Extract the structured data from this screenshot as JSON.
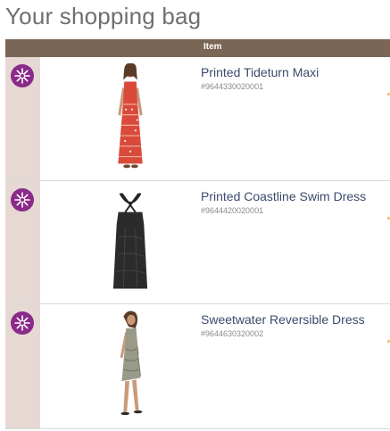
{
  "page": {
    "title": "Your shopping bag"
  },
  "table": {
    "header_item": "Item"
  },
  "items": [
    {
      "name": "Printed Tideturn Maxi",
      "sku": "#9644330020001",
      "badge_icon": "flower-badge-icon",
      "image_icon": "maxi-dress-model-image"
    },
    {
      "name": "Printed Coastline Swim Dress",
      "sku": "#9644420020001",
      "badge_icon": "flower-badge-icon",
      "image_icon": "swim-dress-image"
    },
    {
      "name": "Sweetwater Reversible Dress",
      "sku": "#9644630320002",
      "badge_icon": "flower-badge-icon",
      "image_icon": "reversible-dress-model-image"
    }
  ],
  "colors": {
    "header": "#7a6655",
    "side": "#e6d8d3",
    "badge": "#8a2a8a",
    "link": "#3b4a6b"
  }
}
